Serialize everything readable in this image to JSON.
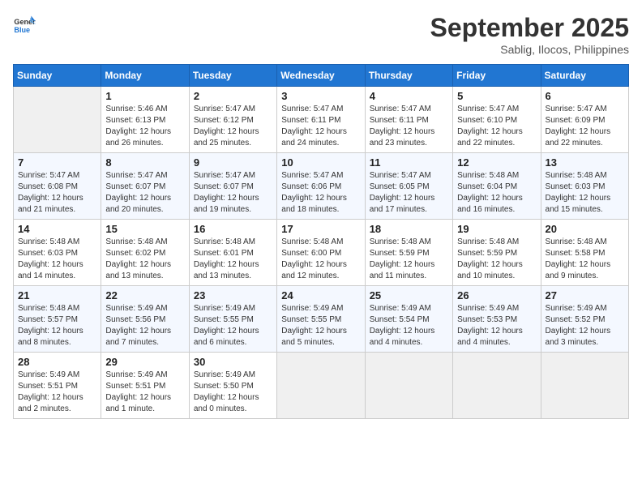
{
  "header": {
    "logo_line1": "General",
    "logo_line2": "Blue",
    "month": "September 2025",
    "location": "Sablig, Ilocos, Philippines"
  },
  "weekdays": [
    "Sunday",
    "Monday",
    "Tuesday",
    "Wednesday",
    "Thursday",
    "Friday",
    "Saturday"
  ],
  "weeks": [
    [
      {
        "day": "",
        "sunrise": "",
        "sunset": "",
        "daylight": ""
      },
      {
        "day": "1",
        "sunrise": "Sunrise: 5:46 AM",
        "sunset": "Sunset: 6:13 PM",
        "daylight": "Daylight: 12 hours and 26 minutes."
      },
      {
        "day": "2",
        "sunrise": "Sunrise: 5:47 AM",
        "sunset": "Sunset: 6:12 PM",
        "daylight": "Daylight: 12 hours and 25 minutes."
      },
      {
        "day": "3",
        "sunrise": "Sunrise: 5:47 AM",
        "sunset": "Sunset: 6:11 PM",
        "daylight": "Daylight: 12 hours and 24 minutes."
      },
      {
        "day": "4",
        "sunrise": "Sunrise: 5:47 AM",
        "sunset": "Sunset: 6:11 PM",
        "daylight": "Daylight: 12 hours and 23 minutes."
      },
      {
        "day": "5",
        "sunrise": "Sunrise: 5:47 AM",
        "sunset": "Sunset: 6:10 PM",
        "daylight": "Daylight: 12 hours and 22 minutes."
      },
      {
        "day": "6",
        "sunrise": "Sunrise: 5:47 AM",
        "sunset": "Sunset: 6:09 PM",
        "daylight": "Daylight: 12 hours and 22 minutes."
      }
    ],
    [
      {
        "day": "7",
        "sunrise": "Sunrise: 5:47 AM",
        "sunset": "Sunset: 6:08 PM",
        "daylight": "Daylight: 12 hours and 21 minutes."
      },
      {
        "day": "8",
        "sunrise": "Sunrise: 5:47 AM",
        "sunset": "Sunset: 6:07 PM",
        "daylight": "Daylight: 12 hours and 20 minutes."
      },
      {
        "day": "9",
        "sunrise": "Sunrise: 5:47 AM",
        "sunset": "Sunset: 6:07 PM",
        "daylight": "Daylight: 12 hours and 19 minutes."
      },
      {
        "day": "10",
        "sunrise": "Sunrise: 5:47 AM",
        "sunset": "Sunset: 6:06 PM",
        "daylight": "Daylight: 12 hours and 18 minutes."
      },
      {
        "day": "11",
        "sunrise": "Sunrise: 5:47 AM",
        "sunset": "Sunset: 6:05 PM",
        "daylight": "Daylight: 12 hours and 17 minutes."
      },
      {
        "day": "12",
        "sunrise": "Sunrise: 5:48 AM",
        "sunset": "Sunset: 6:04 PM",
        "daylight": "Daylight: 12 hours and 16 minutes."
      },
      {
        "day": "13",
        "sunrise": "Sunrise: 5:48 AM",
        "sunset": "Sunset: 6:03 PM",
        "daylight": "Daylight: 12 hours and 15 minutes."
      }
    ],
    [
      {
        "day": "14",
        "sunrise": "Sunrise: 5:48 AM",
        "sunset": "Sunset: 6:03 PM",
        "daylight": "Daylight: 12 hours and 14 minutes."
      },
      {
        "day": "15",
        "sunrise": "Sunrise: 5:48 AM",
        "sunset": "Sunset: 6:02 PM",
        "daylight": "Daylight: 12 hours and 13 minutes."
      },
      {
        "day": "16",
        "sunrise": "Sunrise: 5:48 AM",
        "sunset": "Sunset: 6:01 PM",
        "daylight": "Daylight: 12 hours and 13 minutes."
      },
      {
        "day": "17",
        "sunrise": "Sunrise: 5:48 AM",
        "sunset": "Sunset: 6:00 PM",
        "daylight": "Daylight: 12 hours and 12 minutes."
      },
      {
        "day": "18",
        "sunrise": "Sunrise: 5:48 AM",
        "sunset": "Sunset: 5:59 PM",
        "daylight": "Daylight: 12 hours and 11 minutes."
      },
      {
        "day": "19",
        "sunrise": "Sunrise: 5:48 AM",
        "sunset": "Sunset: 5:59 PM",
        "daylight": "Daylight: 12 hours and 10 minutes."
      },
      {
        "day": "20",
        "sunrise": "Sunrise: 5:48 AM",
        "sunset": "Sunset: 5:58 PM",
        "daylight": "Daylight: 12 hours and 9 minutes."
      }
    ],
    [
      {
        "day": "21",
        "sunrise": "Sunrise: 5:48 AM",
        "sunset": "Sunset: 5:57 PM",
        "daylight": "Daylight: 12 hours and 8 minutes."
      },
      {
        "day": "22",
        "sunrise": "Sunrise: 5:49 AM",
        "sunset": "Sunset: 5:56 PM",
        "daylight": "Daylight: 12 hours and 7 minutes."
      },
      {
        "day": "23",
        "sunrise": "Sunrise: 5:49 AM",
        "sunset": "Sunset: 5:55 PM",
        "daylight": "Daylight: 12 hours and 6 minutes."
      },
      {
        "day": "24",
        "sunrise": "Sunrise: 5:49 AM",
        "sunset": "Sunset: 5:55 PM",
        "daylight": "Daylight: 12 hours and 5 minutes."
      },
      {
        "day": "25",
        "sunrise": "Sunrise: 5:49 AM",
        "sunset": "Sunset: 5:54 PM",
        "daylight": "Daylight: 12 hours and 4 minutes."
      },
      {
        "day": "26",
        "sunrise": "Sunrise: 5:49 AM",
        "sunset": "Sunset: 5:53 PM",
        "daylight": "Daylight: 12 hours and 4 minutes."
      },
      {
        "day": "27",
        "sunrise": "Sunrise: 5:49 AM",
        "sunset": "Sunset: 5:52 PM",
        "daylight": "Daylight: 12 hours and 3 minutes."
      }
    ],
    [
      {
        "day": "28",
        "sunrise": "Sunrise: 5:49 AM",
        "sunset": "Sunset: 5:51 PM",
        "daylight": "Daylight: 12 hours and 2 minutes."
      },
      {
        "day": "29",
        "sunrise": "Sunrise: 5:49 AM",
        "sunset": "Sunset: 5:51 PM",
        "daylight": "Daylight: 12 hours and 1 minute."
      },
      {
        "day": "30",
        "sunrise": "Sunrise: 5:49 AM",
        "sunset": "Sunset: 5:50 PM",
        "daylight": "Daylight: 12 hours and 0 minutes."
      },
      {
        "day": "",
        "sunrise": "",
        "sunset": "",
        "daylight": ""
      },
      {
        "day": "",
        "sunrise": "",
        "sunset": "",
        "daylight": ""
      },
      {
        "day": "",
        "sunrise": "",
        "sunset": "",
        "daylight": ""
      },
      {
        "day": "",
        "sunrise": "",
        "sunset": "",
        "daylight": ""
      }
    ]
  ]
}
